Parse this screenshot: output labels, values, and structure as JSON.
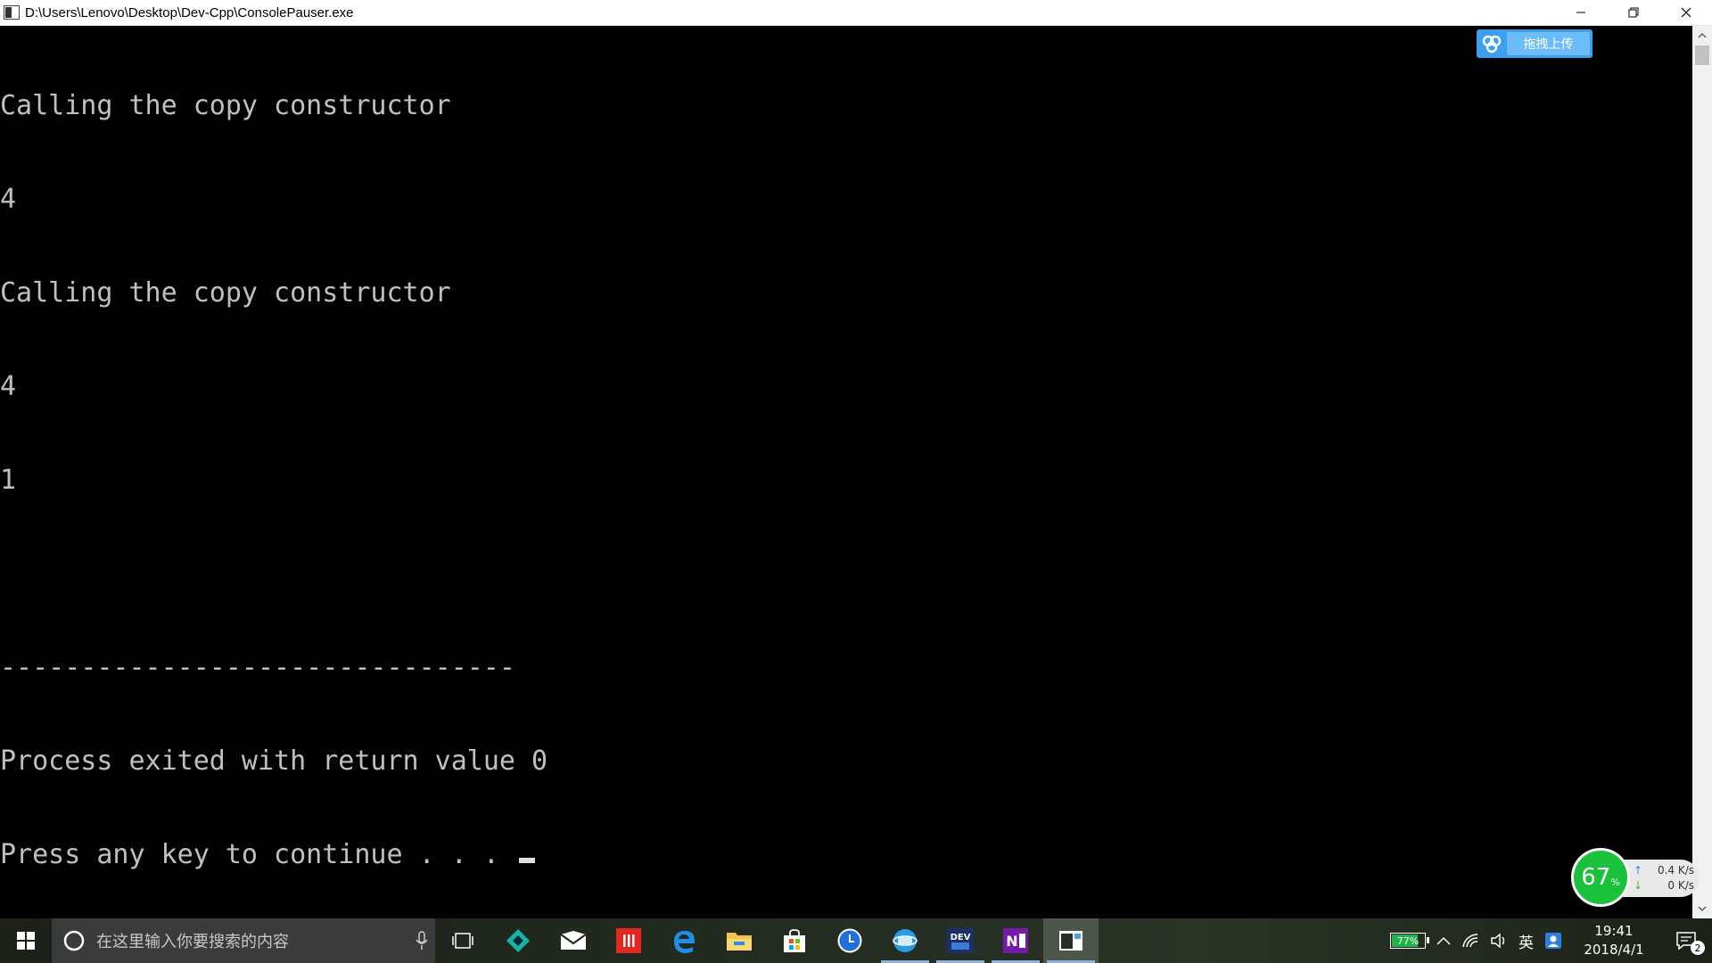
{
  "window": {
    "title": "D:\\Users\\Lenovo\\Desktop\\Dev-Cpp\\ConsolePauser.exe"
  },
  "console": {
    "lines": [
      "Calling the copy constructor",
      "4",
      "Calling the copy constructor",
      "4",
      "1",
      "",
      "--------------------------------",
      "Process exited with return value 0",
      "Press any key to continue . . . "
    ],
    "text_color": "#c0c0c0",
    "background": "#000000"
  },
  "upload_widget": {
    "label": "拖拽上传",
    "color": "#3aa0f0"
  },
  "speed_gadget": {
    "percent": "67",
    "percent_unit": "%",
    "upload_speed": "0.4 K/s",
    "download_speed": "0 K/s",
    "color": "#19c23a"
  },
  "taskbar": {
    "search_placeholder": "在这里输入你要搜索的内容",
    "apps": [
      "task-view",
      "cortana-app",
      "mail",
      "wps-office",
      "edge",
      "file-explorer",
      "store",
      "clock-app",
      "browser",
      "dev-cpp",
      "onenote",
      "console-window"
    ]
  },
  "tray": {
    "battery_percent": "77%",
    "language": "英",
    "time": "19:41",
    "date": "2018/4/1",
    "notification_count": "2"
  }
}
